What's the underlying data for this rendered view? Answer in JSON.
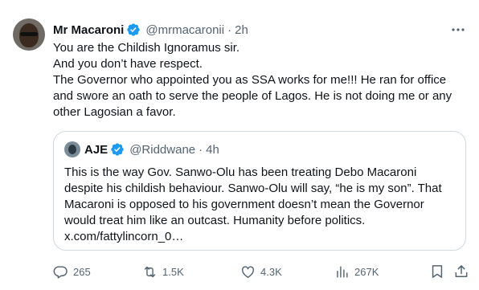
{
  "tweet": {
    "author_name": "Mr Macaroni",
    "author_handle": "@mrmacaronii",
    "separator": "·",
    "time": "2h",
    "lines": [
      "You are the Childish Ignoramus sir.",
      "And you don’t have respect.",
      "The Governor who appointed you as SSA works for me!!! He ran for office",
      "and swore an oath to serve the people of Lagos. He is not doing me or any",
      "other Lagosian a favor."
    ]
  },
  "quote": {
    "author_name": "AJE",
    "author_handle": "@Riddwane",
    "separator": "·",
    "time": "4h",
    "lines": [
      "This is the way Gov. Sanwo-Olu has been treating Debo Macaroni",
      "despite his childish behaviour. Sanwo-Olu will say, “he is my son”. That",
      "Macaroni is opposed to his government doesn’t mean the Governor",
      "would treat him like an outcast. Humanity before politics.",
      "x.com/fattylincorn_0…"
    ]
  },
  "actions": {
    "replies": "265",
    "reposts": "1.5K",
    "likes": "4.3K",
    "views": "267K"
  },
  "colors": {
    "verified_blue": "#1d9bf0",
    "secondary_text": "#536471",
    "border": "#cfd9de"
  },
  "icons": [
    "verified-icon",
    "more-icon",
    "reply-icon",
    "repost-icon",
    "like-icon",
    "views-icon",
    "bookmark-icon",
    "share-icon"
  ]
}
